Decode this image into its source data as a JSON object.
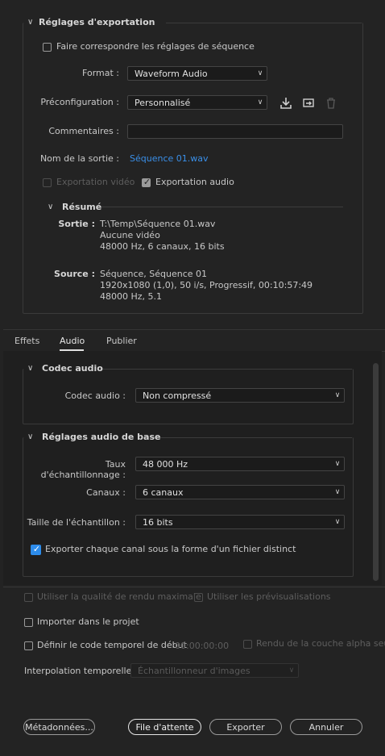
{
  "export_settings": {
    "title": "Réglages d'exportation",
    "match_sequence_label": "Faire correspondre les réglages de séquence",
    "format_label": "Format :",
    "format_value": "Waveform Audio",
    "preset_label": "Préconfiguration :",
    "preset_value": "Personnalisé",
    "comments_label": "Commentaires :",
    "comments_value": "",
    "output_name_label": "Nom de la sortie :",
    "output_name_value": "Séquence 01.wav",
    "export_video_label": "Exportation vidéo",
    "export_audio_label": "Exportation audio",
    "summary": {
      "title": "Résumé",
      "output_key": "Sortie :",
      "output_lines": [
        "T:\\Temp\\Séquence 01.wav",
        "Aucune vidéo",
        "48000  Hz, 6 canaux, 16 bits"
      ],
      "source_key": "Source :",
      "source_lines": [
        "Séquence, Séquence 01",
        "1920x1080 (1,0), 50  i/s, Progressif, 00:10:57:49",
        "48000 Hz, 5.1"
      ]
    }
  },
  "tabs": [
    {
      "label": "Effets"
    },
    {
      "label": "Audio"
    },
    {
      "label": "Publier"
    }
  ],
  "codec": {
    "title": "Codec audio",
    "codec_label": "Codec audio :",
    "codec_value": "Non compressé"
  },
  "basic_audio": {
    "title": "Réglages audio de base",
    "sample_rate_label": "Taux d'échantillonnage :",
    "sample_rate_value": "48 000 Hz",
    "channels_label": "Canaux :",
    "channels_value": "6 canaux",
    "sample_size_label": "Taille de l'échantillon :",
    "sample_size_value": "16 bits",
    "export_each_channel_label": "Exporter chaque canal sous la forme d'un fichier distinct"
  },
  "bottom": {
    "max_render_quality_label": "Utiliser la qualité de rendu maximale",
    "use_previews_label": "Utiliser les prévisualisations",
    "import_into_project_label": "Importer dans le projet",
    "set_start_timecode_label": "Définir le code temporel de début",
    "start_timecode_value": "00:00:00:00",
    "render_alpha_label": "Rendu de la couche alpha seule",
    "time_interpolation_label": "Interpolation temporelle :",
    "time_interpolation_value": "Échantillonneur d'images"
  },
  "buttons": {
    "metadata": "Métadonnées...",
    "queue": "File d'attente",
    "export": "Exporter",
    "cancel": "Annuler"
  },
  "colors": {
    "background": "#232323",
    "accent_blue": "#2d8ceb",
    "link_blue": "#3a8fe8"
  }
}
